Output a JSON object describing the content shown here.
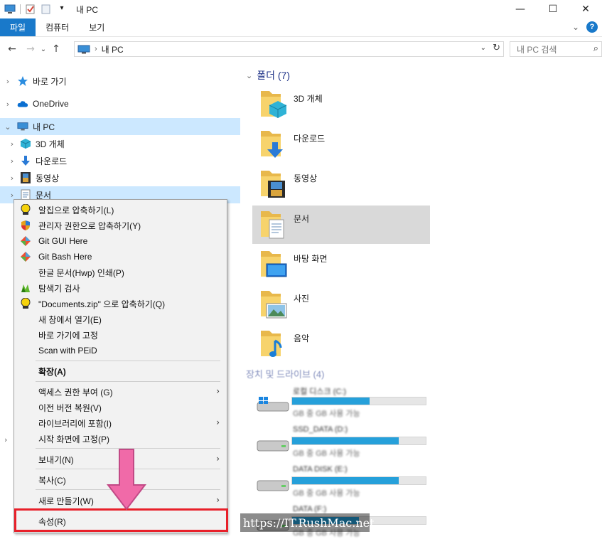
{
  "window": {
    "title": "내 PC",
    "minimize_glyph": "—",
    "maximize_glyph": "☐",
    "close_glyph": "✕"
  },
  "ribbon": {
    "tabs": [
      "파일",
      "컴퓨터",
      "보기"
    ],
    "collapse_glyph": "⌄",
    "help_glyph": "?"
  },
  "address": {
    "back_glyph": "←",
    "forward_glyph": "→",
    "recent_glyph": "⌄",
    "up_glyph": "↑",
    "path": "내 PC",
    "path_sep": "›",
    "dropdown_glyph": "⌄",
    "refresh_glyph": "↻",
    "search_placeholder": "내 PC 검색",
    "search_glyph": "⌕"
  },
  "nav": {
    "items": [
      {
        "label": "바로 가기",
        "chevron": "›",
        "icon": "star-icon"
      },
      {
        "label": "OneDrive",
        "chevron": "›",
        "icon": "cloud-icon"
      },
      {
        "label": "내 PC",
        "chevron": "⌄",
        "icon": "pc-icon",
        "selected": true
      },
      {
        "label": "3D 개체",
        "chevron": "›",
        "icon": "cube-icon"
      },
      {
        "label": "다운로드",
        "chevron": "›",
        "icon": "download-icon"
      },
      {
        "label": "동영상",
        "chevron": "›",
        "icon": "video-icon"
      },
      {
        "label": "문서",
        "chevron": "›",
        "icon": "document-icon",
        "selected": true
      }
    ]
  },
  "folders": {
    "header": "폴더 (7)",
    "header_chevron": "⌄",
    "items": [
      {
        "label": "3D 개체",
        "icon": "cube-icon"
      },
      {
        "label": "다운로드",
        "icon": "download-icon"
      },
      {
        "label": "동영상",
        "icon": "video-icon"
      },
      {
        "label": "문서",
        "icon": "document-icon",
        "selected": true
      },
      {
        "label": "바탕 화면",
        "icon": "desktop-icon"
      },
      {
        "label": "사진",
        "icon": "picture-icon"
      },
      {
        "label": "음악",
        "icon": "music-icon"
      }
    ]
  },
  "drives": {
    "header": "장치 및 드라이브 (4)",
    "items": [
      {
        "name": "로컬 디스크 (C:)",
        "free": "GB 중 GB 사용 가능",
        "used_fraction": 0.58
      },
      {
        "name": "SSD_DATA (D:)",
        "free": "GB 중 GB 사용 가능",
        "used_fraction": 0.8
      },
      {
        "name": "DATA DISK (E:)",
        "free": "GB 중 GB 사용 가능",
        "used_fraction": 0.8
      },
      {
        "name": "DATA (F:)",
        "free": "GB 중 GB 사용 가능",
        "used_fraction": 0.5
      }
    ]
  },
  "context_menu": {
    "items": [
      {
        "label": "알집으로 압축하기(L)",
        "icon": "alzip-icon"
      },
      {
        "label": "관리자 권한으로 압축하기(Y)",
        "icon": "shield-icon"
      },
      {
        "label": "Git GUI Here",
        "icon": "git-icon"
      },
      {
        "label": "Git Bash Here",
        "icon": "git-icon"
      },
      {
        "label": "한글 문서(Hwp) 인쇄(P)",
        "icon": ""
      },
      {
        "label": "탐색기 검사",
        "icon": "scan-icon"
      },
      {
        "label": "\"Documents.zip\" 으로 압축하기(Q)",
        "icon": "alzip-icon"
      },
      {
        "label": "새 창에서 열기(E)",
        "icon": ""
      },
      {
        "label": "바로 가기에 고정",
        "icon": ""
      },
      {
        "label": "Scan with PEiD",
        "icon": ""
      },
      {
        "label": "확장(A)",
        "icon": "",
        "bold": true
      },
      {
        "label": "액세스 권한 부여 (G)",
        "icon": "",
        "submenu": true
      },
      {
        "label": "이전 버전 복원(V)",
        "icon": ""
      },
      {
        "label": "라이브러리에 포함(I)",
        "icon": "",
        "submenu": true
      },
      {
        "label": "시작 화면에 고정(P)",
        "icon": ""
      },
      {
        "label": "보내기(N)",
        "icon": "",
        "submenu": true
      },
      {
        "label": "복사(C)",
        "icon": ""
      },
      {
        "label": "새로 만들기(W)",
        "icon": "",
        "submenu": true
      },
      {
        "label": "속성(R)",
        "icon": ""
      }
    ],
    "submenu_glyph": "›"
  },
  "watermark": "https://IT.RushMac.net",
  "colors": {
    "accent": "#1979ca",
    "selection": "#cce8ff",
    "highlight_box": "#e8202a",
    "arrow": "#f06aa8",
    "drive_bar": "#26a0da"
  }
}
